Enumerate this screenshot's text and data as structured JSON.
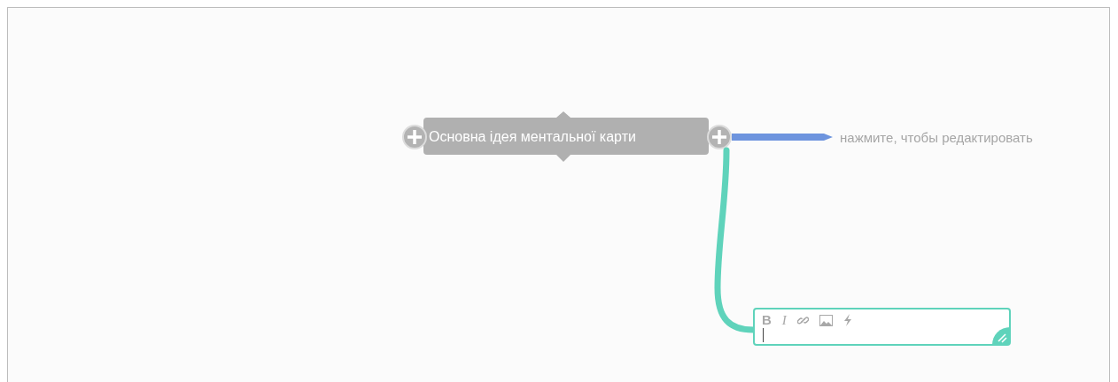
{
  "root_node": {
    "label": "Основна ідея ментальної карти"
  },
  "branches": [
    {
      "kind": "placeholder",
      "label": "нажмите, чтобы редактировать",
      "color": "#6d94de"
    },
    {
      "kind": "editor",
      "color": "#5fd3bb",
      "toolbar": [
        {
          "kind": "bold",
          "label": "B"
        },
        {
          "kind": "italic",
          "label": "I"
        },
        {
          "kind": "link"
        },
        {
          "kind": "image"
        },
        {
          "kind": "lightning"
        }
      ]
    }
  ]
}
